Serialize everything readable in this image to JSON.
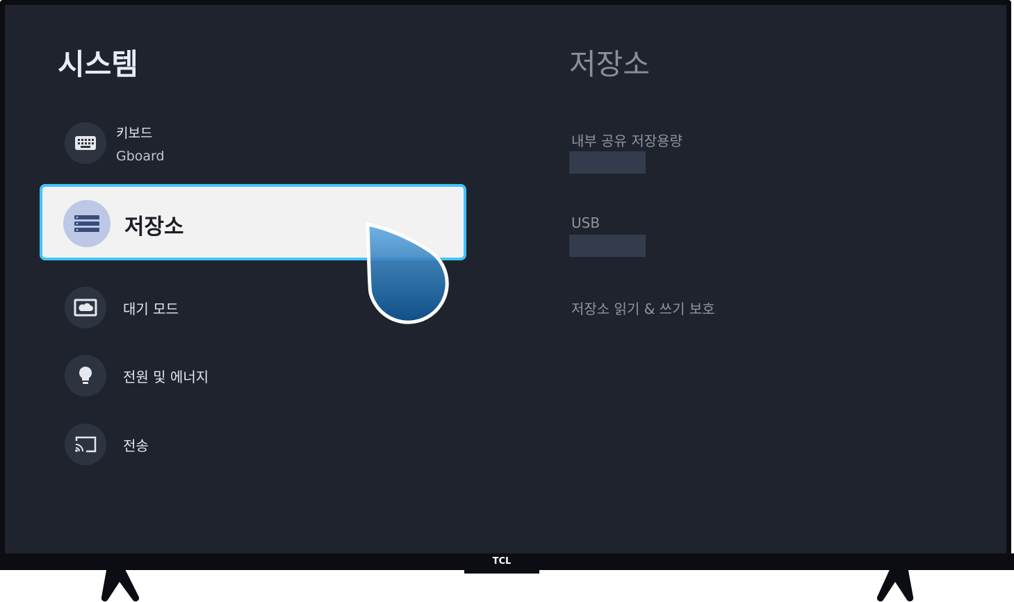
{
  "left_panel": {
    "title": "시스템",
    "items": [
      {
        "label": "키보드",
        "sublabel": "Gboard",
        "icon": "keyboard-icon"
      },
      {
        "label": "저장소",
        "icon": "storage-icon",
        "selected": true
      },
      {
        "label": "대기 모드",
        "icon": "screensaver-icon"
      },
      {
        "label": "전원 및 에너지",
        "icon": "lightbulb-icon"
      },
      {
        "label": "전송",
        "icon": "cast-icon"
      }
    ]
  },
  "right_panel": {
    "title": "저장소",
    "items": [
      {
        "label": "내부 공유 저장용량",
        "value": ""
      },
      {
        "label": "USB",
        "value": ""
      },
      {
        "label": "저장소 읽기 & 쓰기 보호"
      }
    ]
  },
  "device": {
    "brand": "TCL"
  },
  "colors": {
    "screen_bg": "#1f232d",
    "focus_border": "#40c4f7",
    "selected_bg": "#f2f2f3",
    "pointer_fill": "#1f6fb2"
  }
}
